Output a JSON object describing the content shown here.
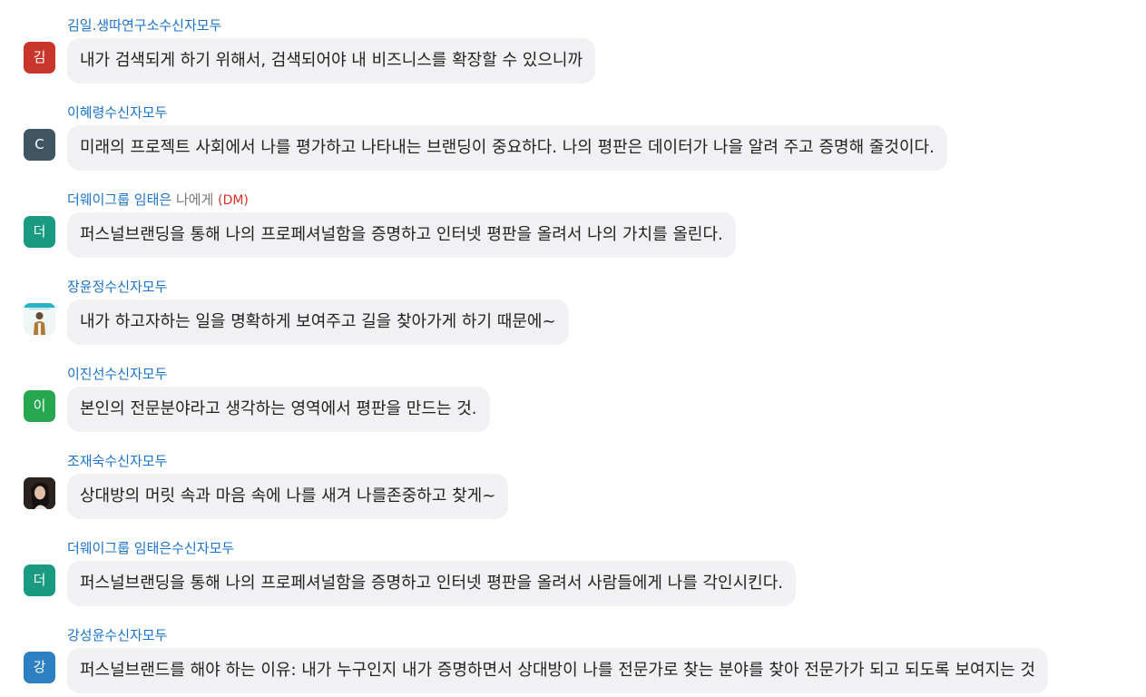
{
  "chat": {
    "messages": [
      {
        "sender": "김일.생따연구소",
        "recipient": "수신자모두",
        "avatar_text": "김",
        "avatar_color": "#c8352a",
        "text": "내가 검색되게 하기 위해서, 검색되어야 내 비즈니스를 확장할 수 있으니까"
      },
      {
        "sender": "이혜령",
        "recipient": "수신자모두",
        "avatar_text": "C",
        "avatar_color": "#3f5561",
        "text": "미래의 프로젝트 사회에서 나를 평가하고 나타내는 브랜딩이 중요하다. 나의 평판은 데이터가 나을 알려 주고 증명해 줄것이다."
      },
      {
        "sender": "더웨이그룹 임태은",
        "separator": " 나에게 ",
        "recipient": "(DM)",
        "avatar_text": "더",
        "avatar_color": "#1a9a80",
        "text": "퍼스널브랜딩을 통해 나의 프로페셔널함을 증명하고 인터넷 평판을 올려서 나의 가치를 올린다."
      },
      {
        "sender": "장윤정",
        "recipient": "수신자모두",
        "avatar_type": "photo-avatar",
        "text": "내가 하고자하는 일을 명확하게 보여주고 길을 찾아가게 하기 때문에~"
      },
      {
        "sender": "이진선",
        "recipient": "수신자모두",
        "avatar_text": "이",
        "avatar_color": "#27a850",
        "text": "본인의 전문분야라고 생각하는 영역에서 평판을 만드는 것."
      },
      {
        "sender": "조재숙",
        "recipient": "수신자모두",
        "avatar_type": "photo-avatar",
        "text": "상대방의 머릿 속과 마음 속에 나를 새겨 나를존중하고 찾게~"
      },
      {
        "sender": "더웨이그룹 임태은",
        "recipient": "수신자모두",
        "avatar_text": "더",
        "avatar_color": "#1a9a80",
        "text": "퍼스널브랜딩을 통해 나의 프로페셔널함을 증명하고 인터넷 평판을 올려서 사람들에게 나를 각인시킨다."
      },
      {
        "sender": "강성윤",
        "recipient": "수신자모두",
        "avatar_text": "강",
        "avatar_color": "#2c7fc0",
        "text": "퍼스널브랜드를 해야 하는 이유: 내가 누구인지 내가 증명하면서 상대방이 나를 전문가로 찾는 분야를 찾아 전문가가 되고 되도록 보여지는 것"
      }
    ]
  }
}
